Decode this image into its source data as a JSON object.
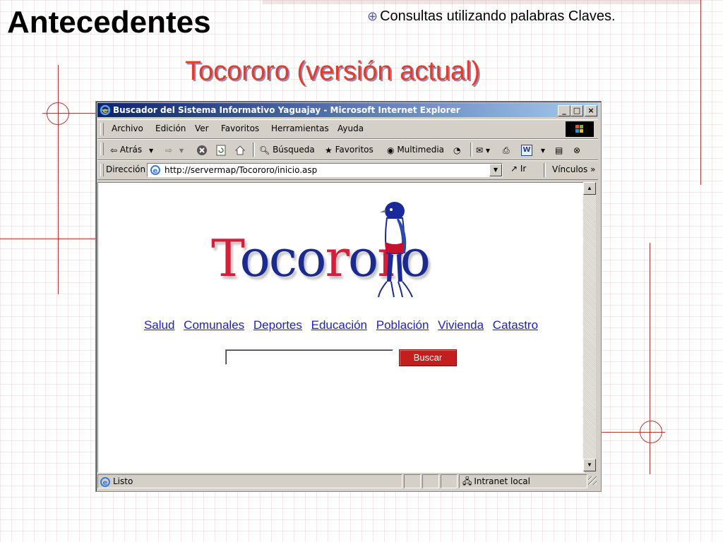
{
  "slide": {
    "title": "Antecedentes",
    "bullet": "Consultas utilizando palabras Claves.",
    "subtitle": "Tocororo (versión actual)"
  },
  "browser": {
    "window_title": "Buscador del Sistema Informativo Yaguajay - Microsoft Internet Explorer",
    "window_buttons": {
      "minimize": "_",
      "maximize": "□",
      "close": "×"
    },
    "menu": [
      "Archivo",
      "Edición",
      "Ver",
      "Favoritos",
      "Herramientas",
      "Ayuda"
    ],
    "toolbar": {
      "back": "Atrás",
      "search": "Búsqueda",
      "favorites": "Favoritos",
      "multimedia": "Multimedia"
    },
    "address": {
      "label": "Dirección",
      "url": "http://servermap/Tocororo/inicio.asp",
      "go": "Ir",
      "links": "Vínculos"
    },
    "status": {
      "text": "Listo",
      "zone": "Intranet local"
    }
  },
  "page": {
    "logo_text": "Tocororo",
    "nav_links": [
      "Salud",
      "Comunales",
      "Deportes",
      "Educación",
      "Población",
      "Vivienda",
      "Catastro"
    ],
    "search_value": "",
    "search_button": "Buscar"
  },
  "colors": {
    "title_red": "#e23d2a",
    "link_blue": "#2020c0",
    "button_red": "#c41e1e",
    "titlebar_start": "#0a246a",
    "titlebar_end": "#a6caf0"
  }
}
